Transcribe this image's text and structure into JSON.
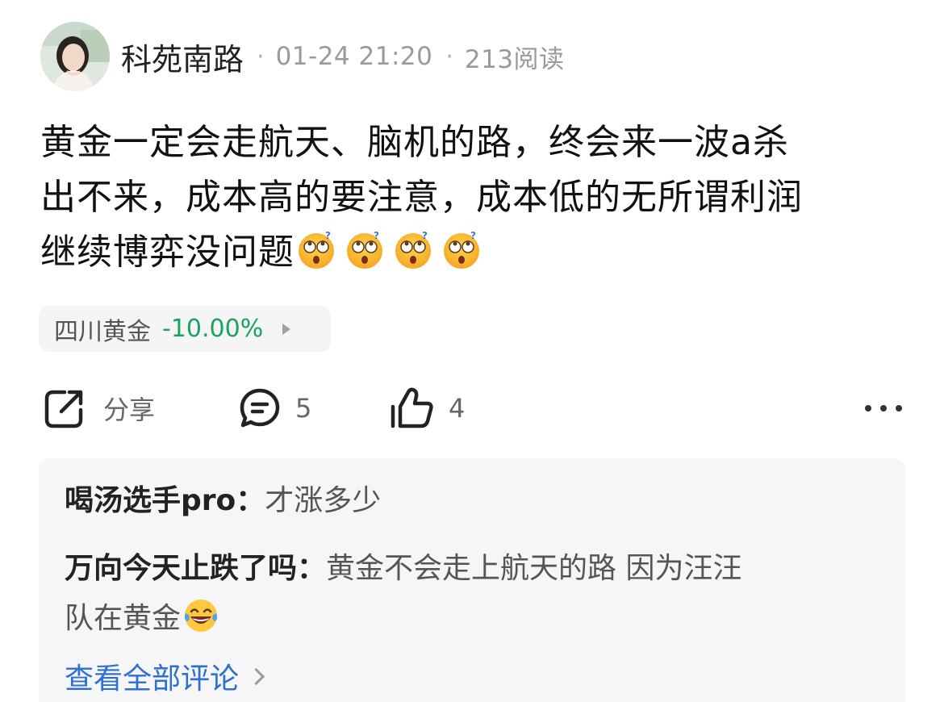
{
  "post": {
    "author": "科苑南路",
    "date": "01-24 21:20",
    "reads": "213阅读",
    "separator": "·",
    "text_line1": "黄金一定会走航天、脑机的路，终会来一波a杀",
    "text_line2": "出不来，成本高的要注意，成本低的无所谓利润",
    "text_line3": "继续博弈没问题",
    "emoji_icons": [
      "face-with-rolling-eyes-icon",
      "face-with-rolling-eyes-icon",
      "face-with-rolling-eyes-icon",
      "face-with-rolling-eyes-icon"
    ]
  },
  "stock": {
    "name": "四川黄金",
    "change": "-10.00%",
    "change_color": "#1aa260"
  },
  "actions": {
    "share_label": "分享",
    "comment_count": "5",
    "like_count": "4"
  },
  "comments": [
    {
      "name": "喝汤选手pro：",
      "text": "才涨多少"
    },
    {
      "name": "万向今天止跌了吗：",
      "text": "黄金不会走上航天的路 因为汪汪",
      "text2": "队在黄金"
    }
  ],
  "view_all": "查看全部评论",
  "colors": {
    "accent_link": "#2e6fd2",
    "stock_down": "#1aa260",
    "comment_bg": "#f6f6f8"
  }
}
